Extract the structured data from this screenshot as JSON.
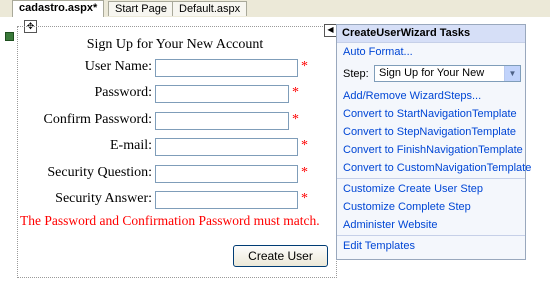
{
  "tabs": [
    {
      "label": "cadastro.aspx*",
      "active": true
    },
    {
      "label": "Start Page",
      "active": false
    },
    {
      "label": "Default.aspx",
      "active": false
    }
  ],
  "form": {
    "title": "Sign Up for Your New Account",
    "fields": [
      {
        "label": "User Name:",
        "required": "*"
      },
      {
        "label": "Password:",
        "required": "*"
      },
      {
        "label": "Confirm Password:",
        "required": "*"
      },
      {
        "label": "E-mail:",
        "required": "*"
      },
      {
        "label": "Security Question:",
        "required": "*"
      },
      {
        "label": "Security Answer:",
        "required": "*"
      }
    ],
    "error_message": "The Password and Confirmation Password must match.",
    "create_button": "Create User"
  },
  "panel": {
    "header": "CreateUserWizard Tasks",
    "auto_format": "Auto Format...",
    "step_label": "Step:",
    "step_value": "Sign Up for Your New",
    "links_group1": [
      "Add/Remove WizardSteps...",
      "Convert to StartNavigationTemplate",
      "Convert to StepNavigationTemplate",
      "Convert to FinishNavigationTemplate",
      "Convert to CustomNavigationTemplate"
    ],
    "links_group2": [
      "Customize Create User Step",
      "Customize Complete Step",
      "Administer Website"
    ],
    "edit_templates": "Edit Templates"
  },
  "colors": {
    "required": "#ff0000",
    "link": "#0046d5",
    "panel_header_bg": "#d6dff7"
  }
}
